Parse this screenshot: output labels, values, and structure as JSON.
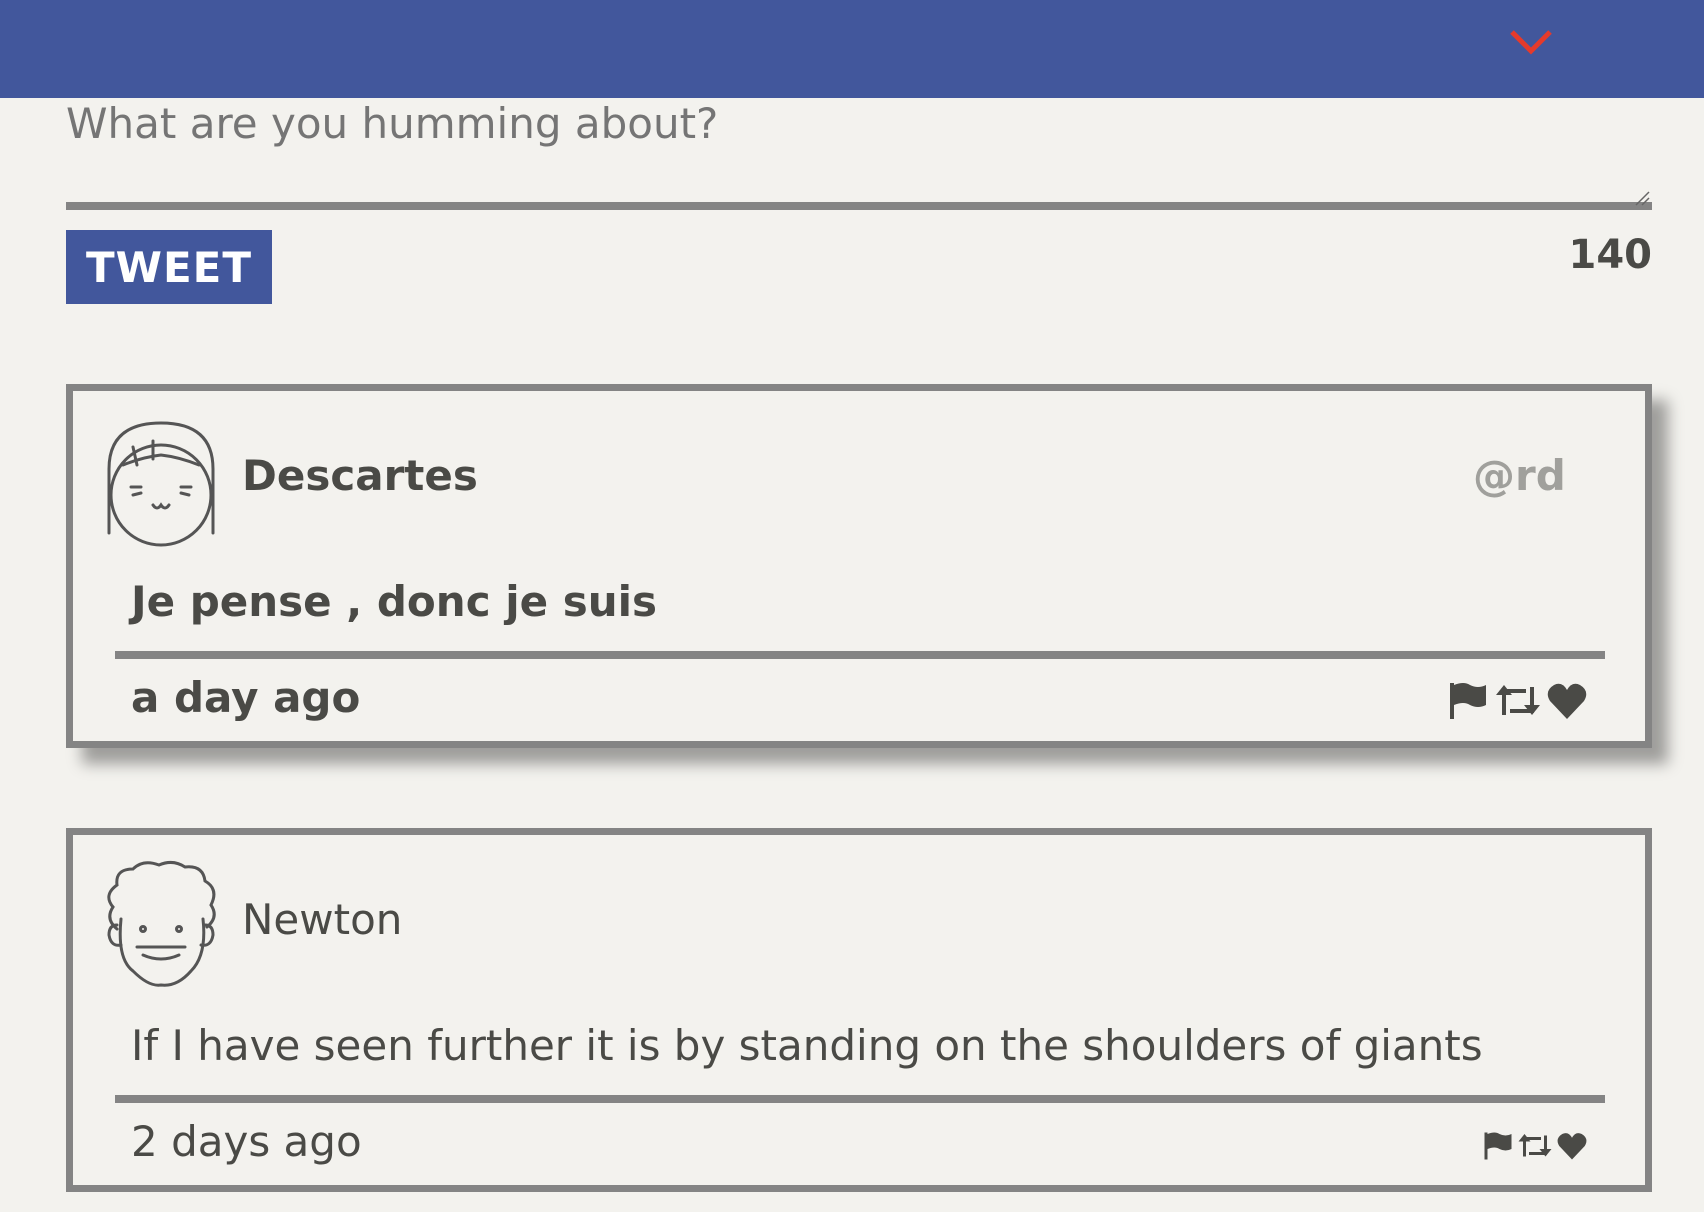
{
  "header": {
    "menu_icon": "chevron-down-icon",
    "accent": "#e53a2b",
    "color": "#42579c"
  },
  "compose": {
    "placeholder": "What are you humming about?",
    "tweet_label": "TWEET",
    "char_count": "140"
  },
  "tweets": [
    {
      "name": "Descartes",
      "handle": "@rd",
      "message": "Je pense , donc je suis",
      "time": "a day ago",
      "avatar_icon": "girl-avatar-icon"
    },
    {
      "name": "Newton",
      "handle": "",
      "message": "If I have seen further it is by standing on the shoulders of giants",
      "time": "2 days ago",
      "avatar_icon": "curly-hair-avatar-icon"
    }
  ]
}
